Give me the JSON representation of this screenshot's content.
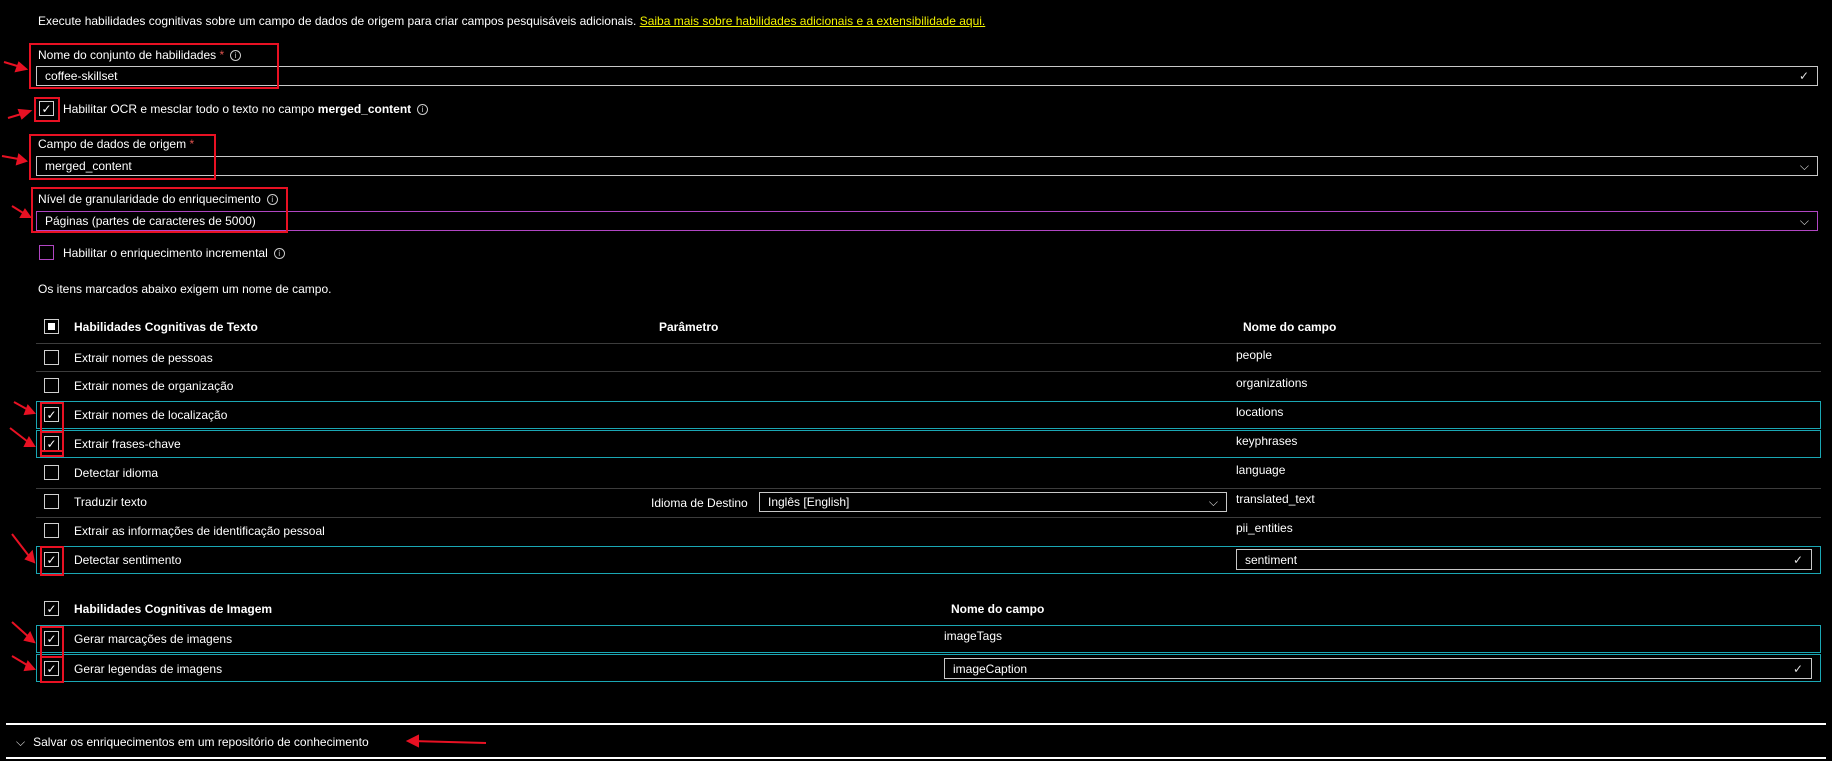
{
  "intro": {
    "text": "Execute habilidades cognitivas sobre um campo de dados de origem para criar campos pesquisáveis adicionais.",
    "link": "Saiba mais sobre habilidades adicionais e a extensibilidade aqui."
  },
  "skillset_name": {
    "label": "Nome do conjunto de habilidades",
    "required": "*",
    "value": "coffee-skillset"
  },
  "ocr": {
    "label_prefix": "Habilitar OCR e mesclar todo o texto no campo",
    "label_bold": "merged_content",
    "checked": true
  },
  "source_field": {
    "label": "Campo de dados de origem",
    "required": "*",
    "value": "merged_content"
  },
  "granularity": {
    "label": "Nível de granularidade do enriquecimento",
    "value": "Páginas (partes de caracteres de 5000)"
  },
  "incremental": {
    "label": "Habilitar o enriquecimento incremental",
    "checked": false
  },
  "note": "Os itens marcados abaixo exigem um nome de campo.",
  "text_skills": {
    "headers": {
      "skill": "Habilidades Cognitivas de Texto",
      "param": "Parâmetro",
      "field": "Nome do campo"
    },
    "rows": [
      {
        "label": "Extrair nomes de pessoas",
        "field": "people",
        "checked": false
      },
      {
        "label": "Extrair nomes de organização",
        "field": "organizations",
        "checked": false
      },
      {
        "label": "Extrair nomes de localização",
        "field": "locations",
        "checked": true
      },
      {
        "label": "Extrair frases-chave",
        "field": "keyphrases",
        "checked": true
      },
      {
        "label": "Detectar idioma",
        "field": "language",
        "checked": false
      },
      {
        "label": "Traduzir texto",
        "field": "translated_text",
        "checked": false,
        "param_label": "Idioma de Destino",
        "param_value": "Inglês [English]"
      },
      {
        "label": "Extrair as informações de identificação pessoal",
        "field": "pii_entities",
        "checked": false
      },
      {
        "label": "Detectar sentimento",
        "field": "sentiment",
        "checked": true
      }
    ]
  },
  "image_skills": {
    "headers": {
      "skill": "Habilidades Cognitivas de Imagem",
      "field": "Nome do campo"
    },
    "rows": [
      {
        "label": "Gerar marcações de imagens",
        "field": "imageTags",
        "checked": true
      },
      {
        "label": "Gerar legendas de imagens",
        "field": "imageCaption",
        "checked": true
      }
    ]
  },
  "knowledge_store": {
    "label": "Salvar os enriquecimentos em um repositório de conhecimento"
  },
  "icons": {
    "check": "check-icon",
    "chevron": "chevron-down-icon",
    "info": "info-icon",
    "arrow": "red-arrow-annotation"
  },
  "colors": {
    "link": "#f3f300",
    "required": "#e0544f",
    "focus": "#b146c2",
    "highlight": "#1aa7b4",
    "annotation": "#e81123"
  }
}
